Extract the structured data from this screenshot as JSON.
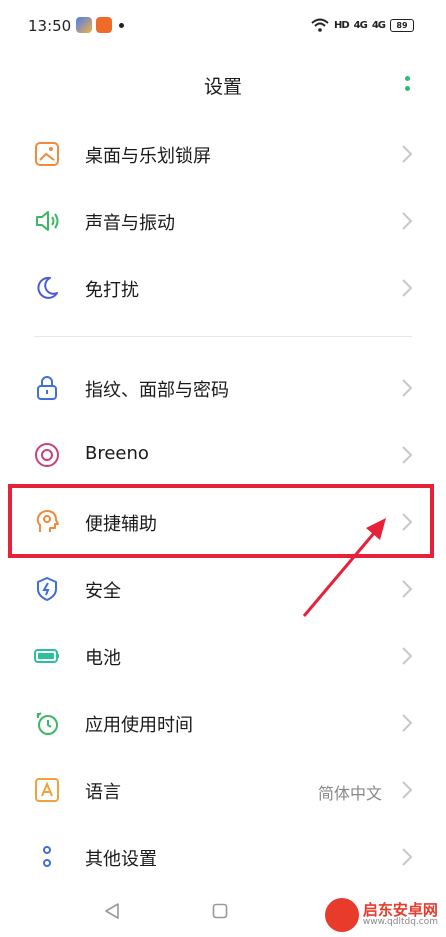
{
  "status_bar": {
    "time": "13:50",
    "network": "HD",
    "signal_1": "4G",
    "signal_2": "4G",
    "battery": "89"
  },
  "header": {
    "title": "设置"
  },
  "group1": [
    {
      "label": "桌面与乐划锁屏",
      "icon": "wallpaper-icon"
    },
    {
      "label": "声音与振动",
      "icon": "speaker-icon"
    },
    {
      "label": "免打扰",
      "icon": "moon-icon"
    }
  ],
  "group2": [
    {
      "label": "指纹、面部与密码",
      "icon": "lock-icon"
    },
    {
      "label": "Breeno",
      "icon": "breeno-icon"
    },
    {
      "label": "便捷辅助",
      "icon": "assist-icon"
    },
    {
      "label": "安全",
      "icon": "shield-icon"
    },
    {
      "label": "电池",
      "icon": "battery-icon"
    },
    {
      "label": "应用使用时间",
      "icon": "timer-icon"
    },
    {
      "label": "语言",
      "icon": "language-icon",
      "value": "简体中文"
    },
    {
      "label": "其他设置",
      "icon": "other-settings-icon"
    }
  ],
  "watermark": {
    "name": "启东安卓网",
    "url": "www.qdltdq.com"
  },
  "colors": {
    "accent_green": "#2ebd6b",
    "highlight_red": "#e8203a"
  }
}
